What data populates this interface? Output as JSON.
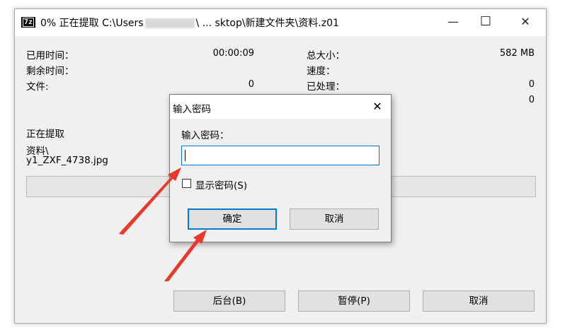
{
  "window": {
    "title_prefix": "0% 正在提取 C:\\Users",
    "title_suffix": "\\ ... sktop\\新建文件夹\\资料.z01",
    "icon_text": "7z",
    "minimize": "—",
    "maximize": "☐",
    "close": "✕"
  },
  "stats": {
    "elapsed_label": "已用时间：",
    "elapsed_value": "00:00:09",
    "remaining_label": "剩余时间：",
    "files_label": "文件:",
    "files_value": "0",
    "total_size_label": "总大小：",
    "total_size_value": "582 MB",
    "speed_label": "速度：",
    "processed_label": "已处理：",
    "processed_value": "0",
    "compressed_value": "0"
  },
  "extract": {
    "status": "正在提取",
    "folder": "资料\\",
    "file": "y1_ZXF_4738.jpg"
  },
  "progress": {
    "fraction": 0.0
  },
  "buttons": {
    "background": "后台(B)",
    "pause": "暂停(P)",
    "cancel": "取消"
  },
  "dialog": {
    "title": "输入密码",
    "close": "✕",
    "prompt": "输入密码：",
    "password_value": "",
    "show_password_label": "显示密码(S)",
    "show_password_checked": false,
    "ok": "确定",
    "cancel": "取消"
  },
  "colors": {
    "accent": "#0078d7",
    "arrow": "#e8392b"
  }
}
